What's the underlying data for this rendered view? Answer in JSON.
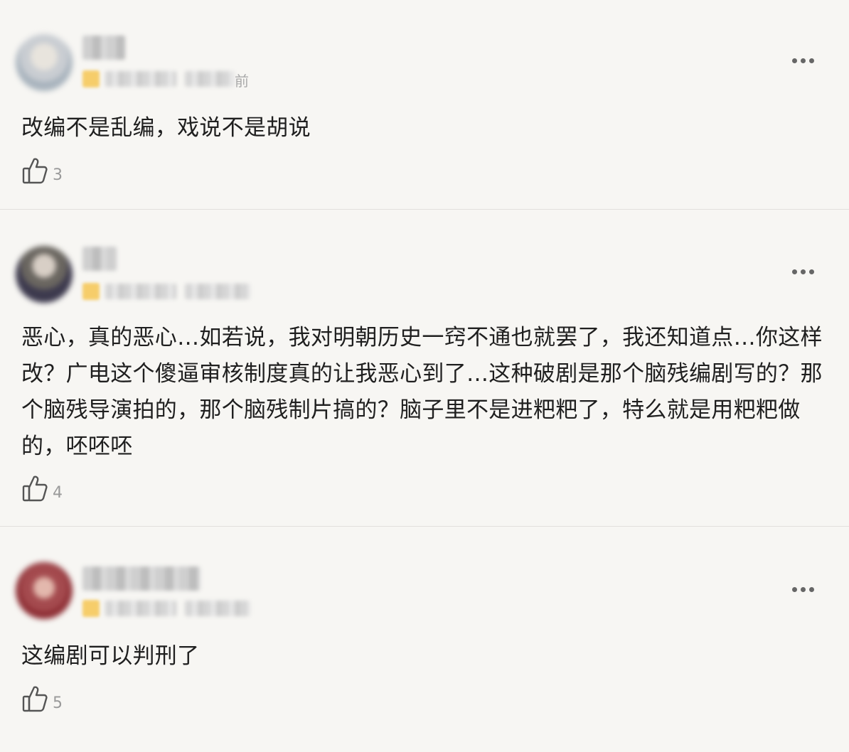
{
  "comments": [
    {
      "time_suffix": "前",
      "text": "改编不是乱编，戏说不是胡说",
      "likes": "3"
    },
    {
      "time_suffix": "",
      "text": "恶心，真的恶心…如若说，我对明朝历史一窍不通也就罢了，我还知道点…你这样改？广电这个傻逼审核制度真的让我恶心到了…这种破剧是那个脑残编剧写的？那个脑残导演拍的，那个脑残制片搞的？脑子里不是进粑粑了，特么就是用粑粑做的，呸呸呸",
      "likes": "4"
    },
    {
      "time_suffix": "",
      "text": "这编剧可以判刑了",
      "likes": "5"
    }
  ],
  "icons": {
    "more": "more-horizontal-icon",
    "like": "thumbs-up-icon"
  },
  "colors": {
    "background": "#f7f6f3",
    "divider": "#e2e0dc",
    "badge": "#f6cd6a",
    "like_count": "#9a9a9a"
  }
}
